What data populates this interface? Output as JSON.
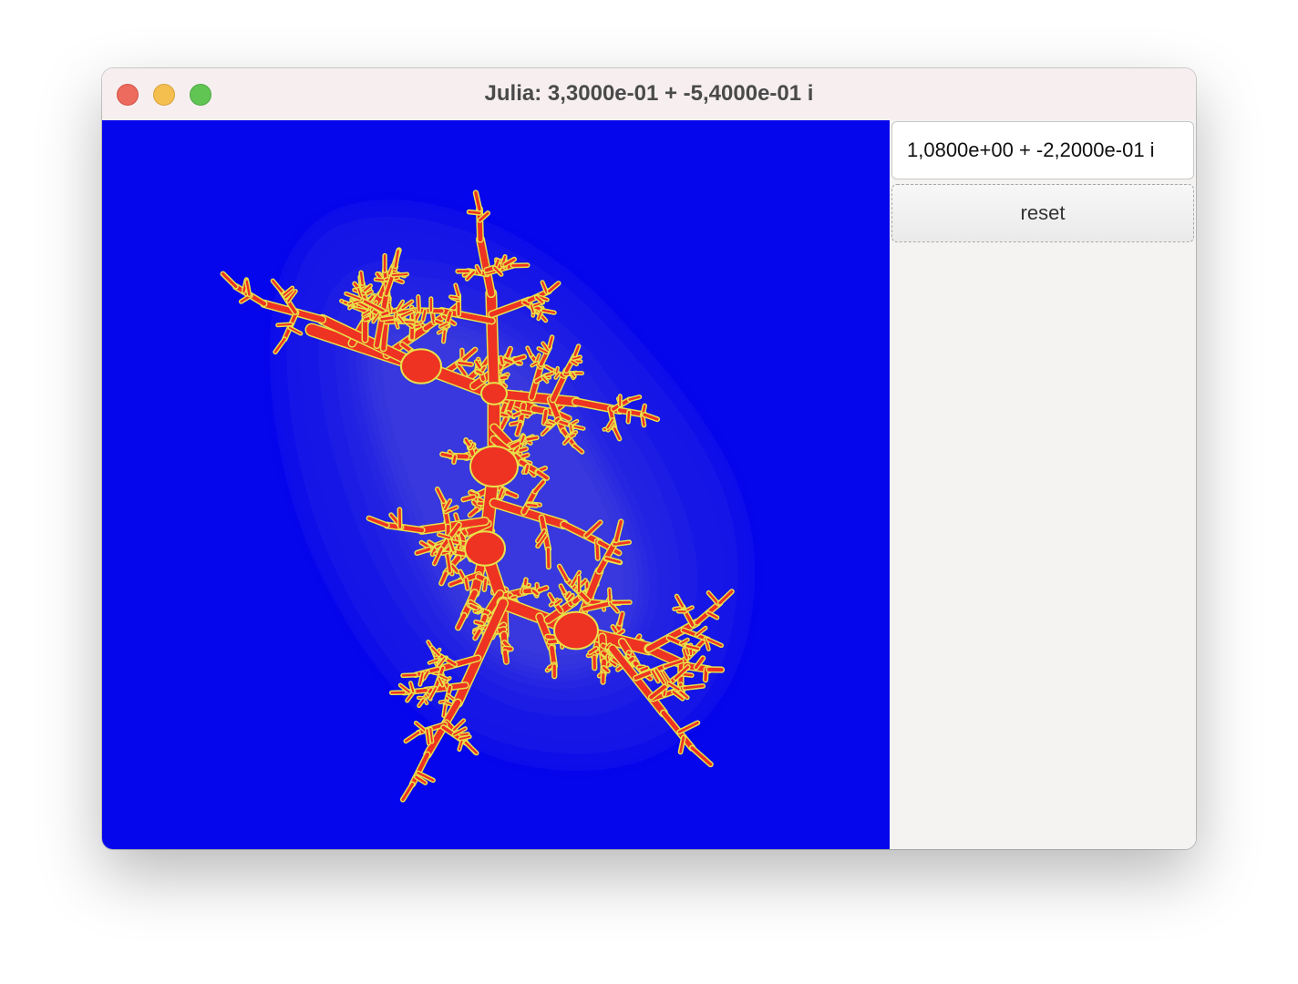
{
  "window": {
    "title": "Julia: 3,3000e-01 + -5,4000e-01 i"
  },
  "controls": {
    "c_value": "1,0800e+00 + -2,2000e-01 i",
    "reset_label": "reset"
  },
  "fractal": {
    "colors": {
      "background": "#0606ed",
      "halo": "#3a3ef0",
      "set_fill": "#ee3322",
      "set_edge": "#e8e14a"
    }
  }
}
